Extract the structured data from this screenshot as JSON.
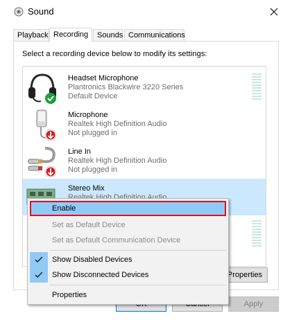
{
  "window": {
    "title": "Sound",
    "close_icon": "close-icon"
  },
  "tabs": [
    {
      "label": "Playback"
    },
    {
      "label": "Recording"
    },
    {
      "label": "Sounds"
    },
    {
      "label": "Communications"
    }
  ],
  "instructions": "Select a recording device below to modify its settings:",
  "devices": [
    {
      "name": "Headset Microphone",
      "driver": "Plantronics Blackwire 3220 Series",
      "status": "Default Device",
      "icon": "headset-icon",
      "badge": "green-check-badge"
    },
    {
      "name": "Microphone",
      "driver": "Realtek High Definition Audio",
      "status": "Not plugged in",
      "icon": "microphone-icon",
      "badge": "red-down-arrow-badge"
    },
    {
      "name": "Line In",
      "driver": "Realtek High Definition Audio",
      "status": "Not plugged in",
      "icon": "line-in-cable-icon",
      "badge": "red-down-arrow-badge"
    },
    {
      "name": "Stereo Mix",
      "driver": "Realtek High Definition Audio",
      "icon": "sound-card-icon"
    }
  ],
  "context_menu": {
    "items": [
      {
        "label": "Enable",
        "state": "highlighted"
      },
      {
        "label": "Set as Default Device",
        "state": "disabled"
      },
      {
        "label": "Set as Default Communication Device",
        "state": "disabled"
      },
      {
        "label": "Show Disabled Devices",
        "checked": true
      },
      {
        "label": "Show Disconnected Devices",
        "checked": true
      },
      {
        "label": "Properties"
      }
    ]
  },
  "buttons": {
    "properties": "Properties",
    "ok": "OK",
    "cancel": "Cancel",
    "apply": "Apply"
  },
  "colors": {
    "selection": "#cce8ff",
    "menu_highlight": "#91c9f7",
    "highlight_outline": "#e0101a",
    "default_badge": "#1e9e3e",
    "unplugged_badge": "#d32020"
  }
}
